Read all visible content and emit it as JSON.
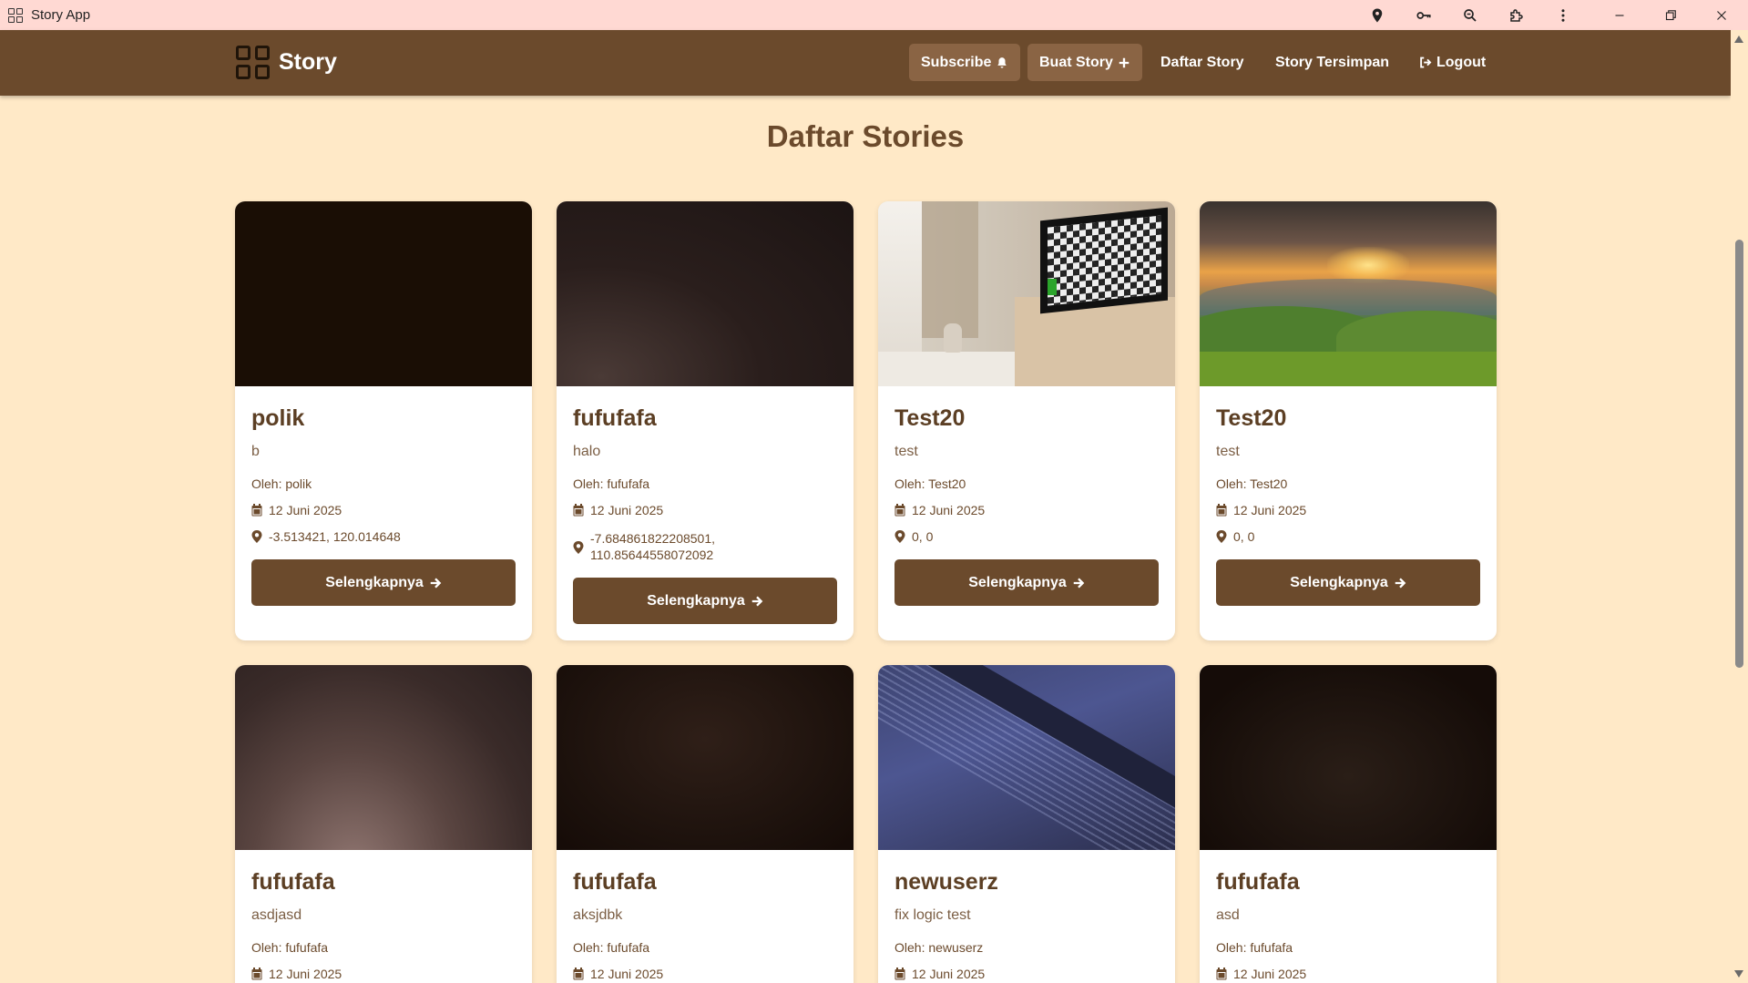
{
  "window": {
    "title": "Story App"
  },
  "navbar": {
    "brand": "Story",
    "subscribe_label": "Subscribe",
    "create_label": "Buat Story",
    "list_label": "Daftar Story",
    "saved_label": "Story Tersimpan",
    "logout_label": "Logout"
  },
  "page": {
    "title": "Daftar Stories"
  },
  "stories": [
    {
      "name": "polik",
      "description": "b",
      "author": "Oleh: polik",
      "date": "12 Juni 2025",
      "location": "-3.513421, 120.014648",
      "button": "Selengkapnya"
    },
    {
      "name": "fufufafa",
      "description": "halo",
      "author": "Oleh: fufufafa",
      "date": "12 Juni 2025",
      "location_line1": "-7.684861822208501,",
      "location_line2": "110.85644558072092",
      "button": "Selengkapnya"
    },
    {
      "name": "Test20",
      "description": "test",
      "author": "Oleh: Test20",
      "date": "12 Juni 2025",
      "location": "0, 0",
      "button": "Selengkapnya"
    },
    {
      "name": "Test20",
      "description": "test",
      "author": "Oleh: Test20",
      "date": "12 Juni 2025",
      "location": "0, 0",
      "button": "Selengkapnya"
    },
    {
      "name": "fufufafa",
      "description": "asdjasd",
      "author": "Oleh: fufufafa",
      "date": "12 Juni 2025"
    },
    {
      "name": "fufufafa",
      "description": "aksjdbk",
      "author": "Oleh: fufufafa",
      "date": "12 Juni 2025"
    },
    {
      "name": "newuserz",
      "description": "fix logic test",
      "author": "Oleh: newuserz",
      "date": "12 Juni 2025"
    },
    {
      "name": "fufufafa",
      "description": "asd",
      "author": "Oleh: fufufafa",
      "date": "12 Juni 2025"
    }
  ],
  "colors": {
    "background": "#ffe9c7",
    "navbar": "#6b4a2c",
    "titlebar": "#ffd9d3",
    "button": "#6b4a2c",
    "nav_button": "#8a6444"
  }
}
